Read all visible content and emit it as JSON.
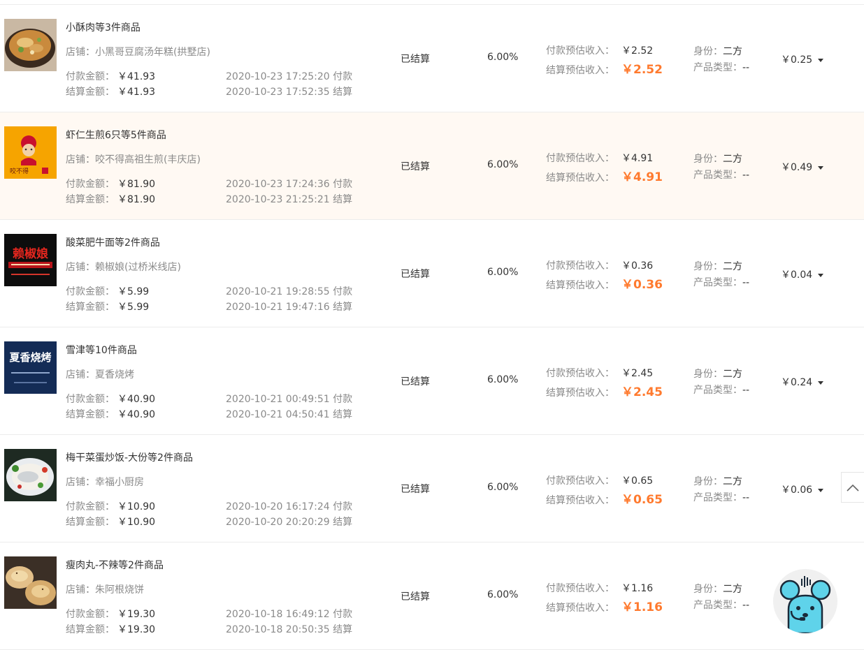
{
  "labels": {
    "shop": "店铺：",
    "pay_amount": "付款金额：",
    "settle_amount": "结算金额：",
    "pay_suffix": "付款",
    "settle_suffix": "结算",
    "pay_est": "付款预估收入：",
    "settle_est": "结算预估收入：",
    "identity": "身份：",
    "product_type": "产品类型："
  },
  "orders": [
    {
      "title": "小酥肉等3件商品",
      "shop": "小黑哥豆腐汤年糕(拱墅店)",
      "pay_amount": "￥41.93",
      "settle_amount": "￥41.93",
      "pay_time": "2020-10-23 17:25:20",
      "settle_time": "2020-10-23 17:52:35",
      "status": "已结算",
      "rate": "6.00%",
      "pay_est": "￥2.52",
      "settle_est": "￥2.52",
      "identity": "二方",
      "product_type": "--",
      "commission": "￥0.25",
      "thumb": "soup-bowl-photo",
      "thumb_text": ""
    },
    {
      "title": "虾仁生煎6只等5件商品",
      "shop": "咬不得高祖生煎(丰庆店)",
      "pay_amount": "￥81.90",
      "settle_amount": "￥81.90",
      "pay_time": "2020-10-23 17:24:36",
      "settle_time": "2020-10-23 21:25:21",
      "status": "已结算",
      "rate": "6.00%",
      "pay_est": "￥4.91",
      "settle_est": "￥4.91",
      "identity": "二方",
      "product_type": "--",
      "commission": "￥0.49",
      "thumb": "mascot-logo",
      "thumb_text": "咬不得"
    },
    {
      "title": "酸菜肥牛面等2件商品",
      "shop": "赖椒娘(过桥米线店)",
      "pay_amount": "￥5.99",
      "settle_amount": "￥5.99",
      "pay_time": "2020-10-21 19:28:55",
      "settle_time": "2020-10-21 19:47:16",
      "status": "已结算",
      "rate": "6.00%",
      "pay_est": "￥0.36",
      "settle_est": "￥0.36",
      "identity": "二方",
      "product_type": "--",
      "commission": "￥0.04",
      "thumb": "red-text-logo",
      "thumb_text": "赖椒娘"
    },
    {
      "title": "雪津等10件商品",
      "shop": "夏香烧烤",
      "pay_amount": "￥40.90",
      "settle_amount": "￥40.90",
      "pay_time": "2020-10-21 00:49:51",
      "settle_time": "2020-10-21 04:50:41",
      "status": "已结算",
      "rate": "6.00%",
      "pay_est": "￥2.45",
      "settle_est": "￥2.45",
      "identity": "二方",
      "product_type": "--",
      "commission": "￥0.24",
      "thumb": "navy-text-logo",
      "thumb_text": "夏香烧烤"
    },
    {
      "title": "梅干菜蛋炒饭-大份等2件商品",
      "shop": "幸福小厨房",
      "pay_amount": "￥10.90",
      "settle_amount": "￥10.90",
      "pay_time": "2020-10-20 16:17:24",
      "settle_time": "2020-10-20 20:20:29",
      "status": "已结算",
      "rate": "6.00%",
      "pay_est": "￥0.65",
      "settle_est": "￥0.65",
      "identity": "二方",
      "product_type": "--",
      "commission": "￥0.06",
      "thumb": "fish-dish-photo",
      "thumb_text": ""
    },
    {
      "title": "瘦肉丸-不辣等2件商品",
      "shop": "朱阿根烧饼",
      "pay_amount": "￥19.30",
      "settle_amount": "￥19.30",
      "pay_time": "2020-10-18 16:49:12",
      "settle_time": "2020-10-18 20:50:35",
      "status": "已结算",
      "rate": "6.00%",
      "pay_est": "￥1.16",
      "settle_est": "￥1.16",
      "identity": "二方",
      "product_type": "--",
      "commission": "",
      "thumb": "pastry-photo",
      "thumb_text": ""
    }
  ],
  "controls": {
    "back_to_top_icon": "chevron-up-icon",
    "assistant_icon": "headset-mascot-icon"
  }
}
